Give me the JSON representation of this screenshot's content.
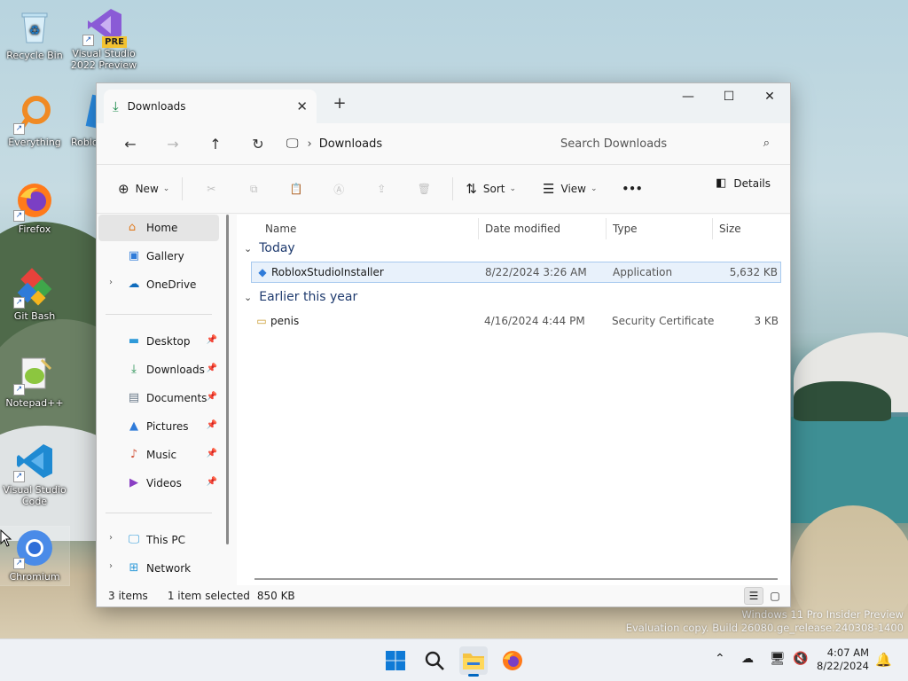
{
  "desktop": {
    "icons": [
      {
        "label": "Recycle Bin",
        "icon": "recycle-bin-icon"
      },
      {
        "label": "Visual Studio 2022 Preview",
        "icon": "visual-studio-icon",
        "badge": "PRE"
      },
      {
        "label": "Everything",
        "icon": "everything-search-icon"
      },
      {
        "label": "Roblo",
        "icon": "roblox-icon"
      },
      {
        "label": "Firefox",
        "icon": "firefox-icon"
      },
      {
        "label": "Git Bash",
        "icon": "git-bash-icon"
      },
      {
        "label": "Notepad++",
        "icon": "notepad-plus-plus-icon"
      },
      {
        "label": "Visual Studio Code",
        "icon": "vscode-icon"
      },
      {
        "label": "Chromium",
        "icon": "chromium-icon"
      }
    ],
    "watermark": {
      "line1": "Windows 11 Pro Insider Preview",
      "line2": "Evaluation copy. Build 26080.ge_release.240308-1400"
    }
  },
  "explorer": {
    "tab_title": "Downloads",
    "address": {
      "crumb": "Downloads"
    },
    "search": {
      "placeholder": "Search Downloads"
    },
    "toolbar": {
      "new_label": "New",
      "sort_label": "Sort",
      "view_label": "View",
      "more_label": "•••",
      "details_label": "Details"
    },
    "sidebar": {
      "items": [
        {
          "label": "Home",
          "icon": "home-icon"
        },
        {
          "label": "Gallery",
          "icon": "gallery-icon"
        },
        {
          "label": "OneDrive",
          "icon": "cloud-icon"
        },
        {
          "label": "Desktop",
          "icon": "desktop-folder-icon"
        },
        {
          "label": "Downloads",
          "icon": "download-icon"
        },
        {
          "label": "Documents",
          "icon": "documents-icon"
        },
        {
          "label": "Pictures",
          "icon": "pictures-icon"
        },
        {
          "label": "Music",
          "icon": "music-icon"
        },
        {
          "label": "Videos",
          "icon": "videos-icon"
        },
        {
          "label": "This PC",
          "icon": "computer-icon"
        },
        {
          "label": "Network",
          "icon": "network-icon"
        }
      ]
    },
    "columns": {
      "name": "Name",
      "date": "Date modified",
      "type": "Type",
      "size": "Size"
    },
    "groups": [
      {
        "label": "Today",
        "rows": [
          {
            "name": "RobloxStudioInstaller",
            "date": "8/22/2024 3:26 AM",
            "type": "Application",
            "size": "5,632 KB"
          }
        ]
      },
      {
        "label": "Earlier this year",
        "rows": [
          {
            "name": "penis",
            "date": "4/16/2024 4:44 PM",
            "type": "Security Certificate",
            "size": "3 KB"
          }
        ]
      }
    ],
    "status": {
      "count": "3 items",
      "selected": "1 item selected",
      "size": "850 KB"
    }
  },
  "taskbar": {
    "time": "4:07 AM",
    "date": "8/22/2024"
  },
  "colors": {
    "accent": "#0067c0",
    "selection": "#e8f1fb"
  }
}
